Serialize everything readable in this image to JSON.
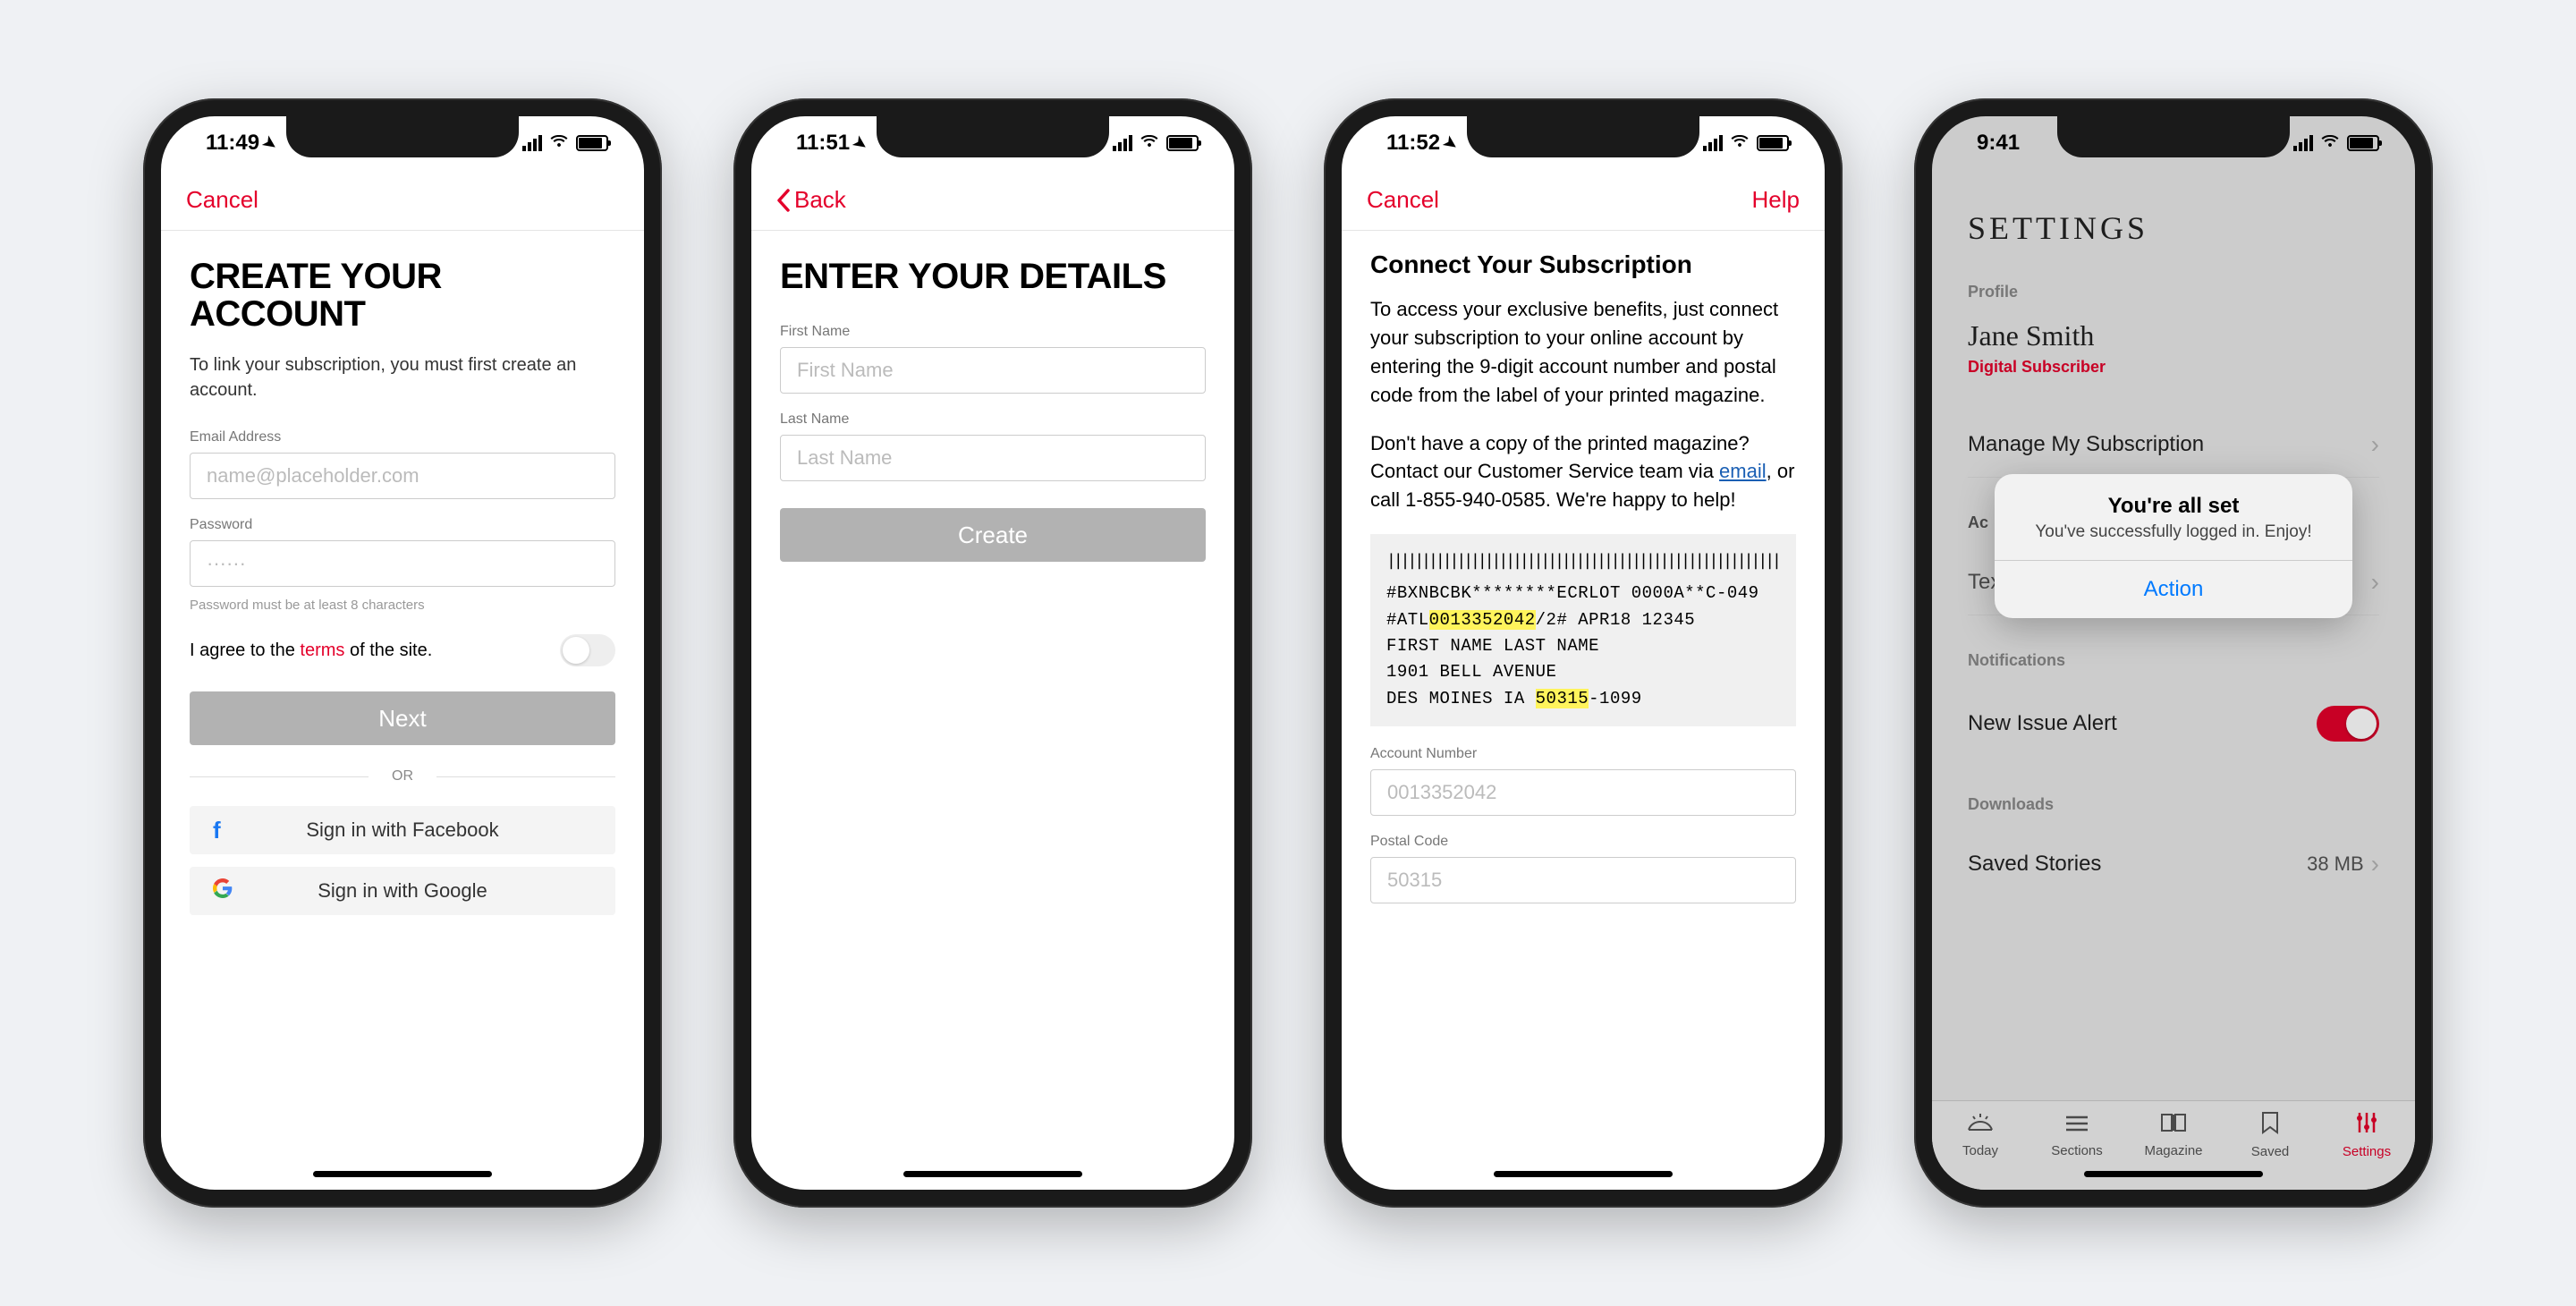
{
  "screen1": {
    "time": "11:49",
    "nav_cancel": "Cancel",
    "title": "CREATE YOUR ACCOUNT",
    "subtitle": "To link your subscription, you must first create an account.",
    "email_label": "Email Address",
    "email_placeholder": "name@placeholder.com",
    "password_label": "Password",
    "password_placeholder": "······",
    "password_hint": "Password must be at least 8 characters",
    "terms_prefix": "I agree to the ",
    "terms_link": "terms",
    "terms_suffix": " of the site.",
    "next_btn": "Next",
    "or": "OR",
    "facebook": "Sign in with Facebook",
    "google": "Sign in with Google"
  },
  "screen2": {
    "time": "11:51",
    "nav_back": "Back",
    "title": "ENTER YOUR DETAILS",
    "first_label": "First Name",
    "first_placeholder": "First Name",
    "last_label": "Last Name",
    "last_placeholder": "Last Name",
    "create_btn": "Create"
  },
  "screen3": {
    "time": "11:52",
    "nav_cancel": "Cancel",
    "nav_help": "Help",
    "title": "Connect Your Subscription",
    "para1": "To access your exclusive benefits, just connect your subscription to your online account by entering the 9-digit account number and postal code from the label of your printed magazine.",
    "para2a": "Don't have a copy of the printed magazine? Contact our Customer Service team via ",
    "para2_link": "email",
    "para2b": ", or call 1-855-940-0585. We're happy to help!",
    "label_line1a": "#BXNBCBK********ECRLOT 0000A**C-049",
    "label_line2_pre": "#ATL",
    "label_line2_hl": "0013352042",
    "label_line2_post": "/2#    APR18    12345",
    "label_line3": "FIRST NAME   LAST NAME",
    "label_line4": "1901 BELL AVENUE",
    "label_line5_pre": "DES MOINES IA ",
    "label_line5_hl": "50315",
    "label_line5_post": "-1099",
    "acct_label": "Account Number",
    "acct_placeholder": "0013352042",
    "postal_label": "Postal Code",
    "postal_placeholder": "50315"
  },
  "screen4": {
    "time": "9:41",
    "title": "SETTINGS",
    "profile_section": "Profile",
    "profile_name": "Jane Smith",
    "profile_sub": "Digital Subscriber",
    "manage": "Manage My Subscription",
    "acc_section_partial": "Ac",
    "text_partial": "Tex",
    "notif_section": "Notifications",
    "new_issue": "New Issue Alert",
    "downloads_section": "Downloads",
    "saved_stories": "Saved Stories",
    "saved_size": "38 MB",
    "alert_title": "You're all set",
    "alert_msg": "You've successfully logged in. Enjoy!",
    "alert_action": "Action",
    "tabs": {
      "today": "Today",
      "sections": "Sections",
      "magazine": "Magazine",
      "saved": "Saved",
      "settings": "Settings"
    }
  }
}
